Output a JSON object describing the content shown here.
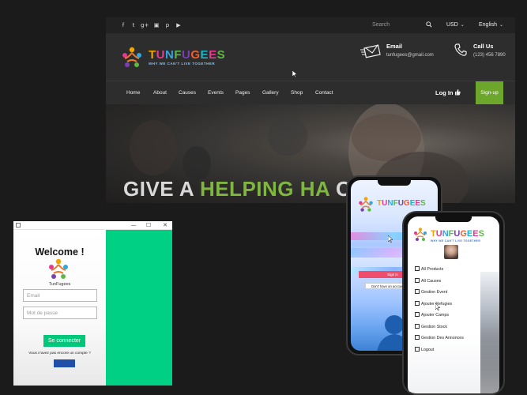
{
  "site": {
    "social_icons": [
      "facebook-icon",
      "twitter-icon",
      "google-plus-icon",
      "instagram-icon",
      "pinterest-icon",
      "youtube-icon"
    ],
    "social_glyphs": [
      "f",
      "t",
      "g+",
      "▣",
      "p",
      "▶"
    ],
    "search_placeholder": "Search",
    "currency": "USD",
    "language": "English",
    "brand": "TUNFUGEES",
    "tagline": "WHY WE CAN'T LIVE TOGETHER",
    "email_title": "Email",
    "email_value": "tunfugees@gmail.com",
    "call_title": "Call Us",
    "call_value": "(123) 456 7890",
    "nav": [
      "Home",
      "About",
      "Causes",
      "Events",
      "Pages",
      "Gallery",
      "Shop",
      "Contact"
    ],
    "login": "Log In",
    "signup": "Sign-up",
    "hero_title_1": "GIVE A ",
    "hero_title_2": "HELPING HA",
    "hero_title_3": "   OSE"
  },
  "login_window": {
    "controls": [
      "—",
      "☐",
      "✕"
    ],
    "welcome": "Welcome !",
    "brand": "TunFugees",
    "email_placeholder": "Email",
    "password_placeholder": "Mot de passe",
    "connect_button": "Se connecter",
    "no_account_text": "Vous n'avez pas encore un compte ?"
  },
  "phone1": {
    "brand": "TUNFUGEES",
    "signin": "Sign in",
    "no_account": "Don't have an account?"
  },
  "phone2": {
    "brand": "TUNFUGEES",
    "tagline": "WHY WE CAN'T LIVE TOGETHER",
    "menu": [
      "All Products",
      "All Causes",
      "Gestion Event",
      "Ajouter Refugies",
      "Ajouter Camps",
      "Gestion Stock",
      "Gestion Des Annonces",
      "Logout"
    ]
  },
  "colors": {
    "accent_green": "#6ca72b",
    "login_green": "#00d084",
    "signin_red": "#f04d6d"
  }
}
